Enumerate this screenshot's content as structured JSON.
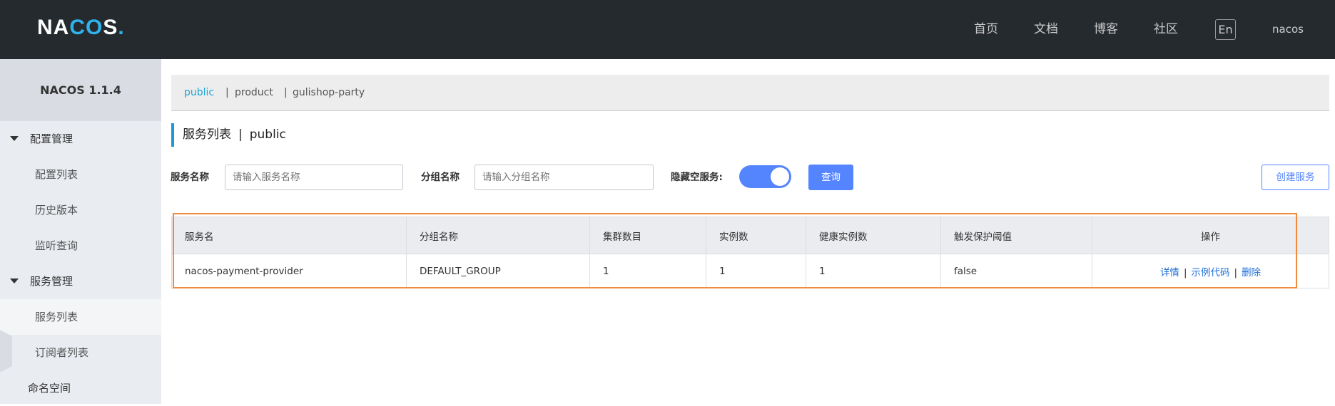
{
  "header": {
    "logo": "NACOS.",
    "nav": [
      "首页",
      "文档",
      "博客",
      "社区"
    ],
    "lang": "En",
    "user": "nacos"
  },
  "sidebar": {
    "title": "NACOS 1.1.4",
    "groups": [
      {
        "label": "配置管理",
        "items": [
          "配置列表",
          "历史版本",
          "监听查询"
        ]
      },
      {
        "label": "服务管理",
        "items": [
          "服务列表",
          "订阅者列表"
        ]
      }
    ],
    "namespace": "命名空间",
    "active": "服务列表"
  },
  "namespaces": [
    "public",
    "product",
    "gulishop-party"
  ],
  "page": {
    "title": "服务列表",
    "namespace": "public"
  },
  "filters": {
    "service_label": "服务名称",
    "service_placeholder": "请输入服务名称",
    "group_label": "分组名称",
    "group_placeholder": "请输入分组名称",
    "hide_empty_label": "隐藏空服务:",
    "hide_empty": true,
    "query": "查询",
    "create": "创建服务"
  },
  "table": {
    "headers": [
      "服务名",
      "分组名称",
      "集群数目",
      "实例数",
      "健康实例数",
      "触发保护阈值",
      "操作"
    ],
    "rows": [
      {
        "name": "nacos-payment-provider",
        "group": "DEFAULT_GROUP",
        "clusters": "1",
        "instances": "1",
        "healthy": "1",
        "threshold": "false",
        "actions": [
          "详情",
          "示例代码",
          "删除"
        ]
      }
    ]
  },
  "colors": {
    "accent": "#5584ff",
    "header_bg": "#252a2f",
    "highlight": "#f08a3c"
  }
}
